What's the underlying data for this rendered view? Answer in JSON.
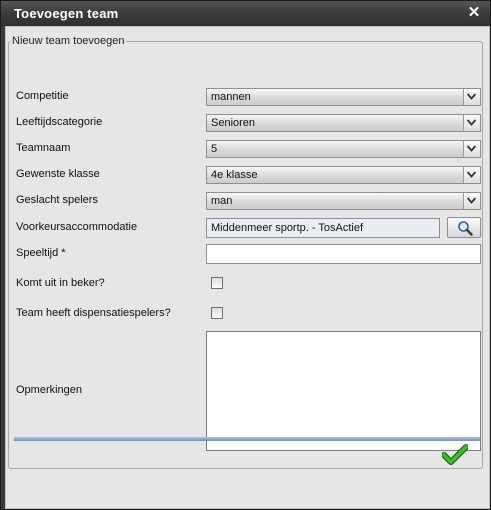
{
  "window": {
    "title": "Toevoegen team"
  },
  "group": {
    "legend": "Nieuw team toevoegen"
  },
  "fields": {
    "competitie": {
      "label": "Competitie",
      "value": "mannen"
    },
    "leeftijdscategorie": {
      "label": "Leeftijdscategorie",
      "value": "Senioren"
    },
    "teamnaam": {
      "label": "Teamnaam",
      "value": "5"
    },
    "gewenste_klasse": {
      "label": "Gewenste klasse",
      "value": "4e klasse"
    },
    "geslacht": {
      "label": "Geslacht spelers",
      "value": "man"
    },
    "accommodatie": {
      "label": "Voorkeursaccommodatie",
      "value": "Middenmeer sportp. - TosActief"
    },
    "speeltijd": {
      "label": "Speeltijd *",
      "value": ""
    },
    "beker": {
      "label": "Komt uit in beker?",
      "checked": false
    },
    "dispensatie": {
      "label": "Team heeft dispensatiespelers?",
      "checked": false
    },
    "opmerkingen": {
      "label": "Opmerkingen",
      "value": ""
    }
  },
  "icons": {
    "close": "close-icon",
    "lookup": "magnifier-icon",
    "submit": "checkmark-icon",
    "dropdown": "chevron-down-icon"
  },
  "colors": {
    "submit_check": "#2e9a1f",
    "divider": "#7d9ccb"
  }
}
